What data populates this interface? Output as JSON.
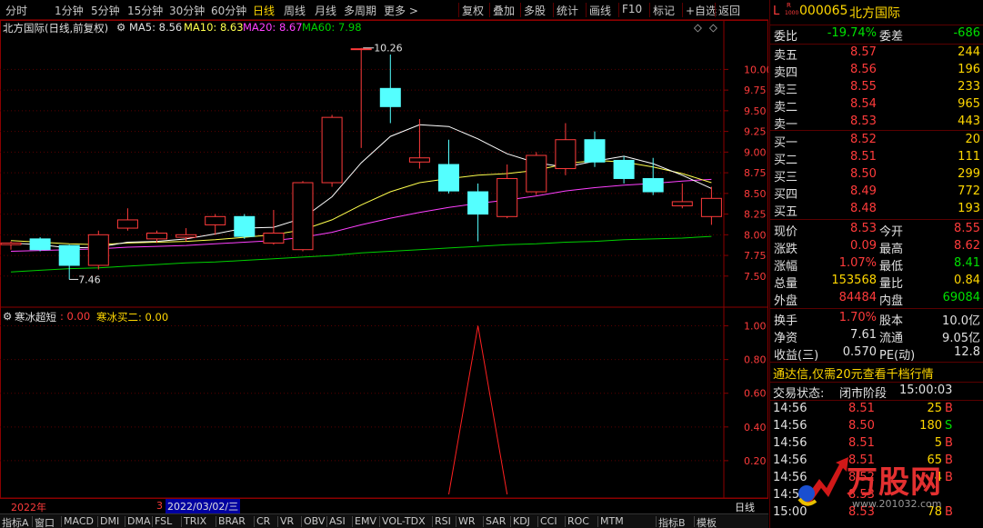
{
  "toolbar": {
    "periods": [
      "分时",
      "1分钟",
      "5分钟",
      "15分钟",
      "30分钟",
      "60分钟",
      "日线",
      "周线",
      "月线",
      "多周期",
      "更多 >"
    ],
    "active_period": "日线",
    "buttons": [
      "复权",
      "叠加",
      "多股",
      "统计",
      "画线",
      "F10",
      "标记",
      "+自选",
      "返回"
    ]
  },
  "chart_header": {
    "stock_title": "北方国际(日线,前复权)",
    "ma5": "MA5: 8.56",
    "ma10": "MA10: 8.63",
    "ma20": "MA20: 8.67",
    "ma60": "MA60: 7.98"
  },
  "indicator_header": {
    "name": "寒冰超短",
    "v1": ": 0.00",
    "v2": "寒冰买二: 0.00"
  },
  "timeline": {
    "year": "2022年",
    "marker": "3",
    "date": "2022/03/02/三"
  },
  "period_label": "日线",
  "annotations": {
    "high": "10.26",
    "low": "7.46"
  },
  "bottom_tabs": [
    "指标A",
    "窗口",
    "MACD",
    "DMI",
    "DMA",
    "FSL",
    "TRIX",
    "BRAR",
    "CR",
    "VR",
    "OBV",
    "ASI",
    "EMV",
    "VOL-TDX",
    "RSI",
    "WR",
    "SAR",
    "KDJ",
    "CCI",
    "ROC",
    "MTM",
    "指标B",
    "模板"
  ],
  "colors": {
    "up": "#ff3b3b",
    "down": "#54ffff",
    "ma5": "#ffffff",
    "ma10": "#ffff4d",
    "ma20": "#ff40ff",
    "ma60": "#00d000",
    "border": "#8b0000"
  },
  "quote": {
    "code": "000065",
    "name": "北方国际",
    "badge_l": "L",
    "badge_r": "R",
    "badge_num": "1000",
    "weibi_label": "委比",
    "weibi": "-19.74%",
    "weicha_label": "委差",
    "weicha": "-686",
    "asks": [
      {
        "label": "卖五",
        "price": "8.57",
        "vol": "244"
      },
      {
        "label": "卖四",
        "price": "8.56",
        "vol": "196"
      },
      {
        "label": "卖三",
        "price": "8.55",
        "vol": "233"
      },
      {
        "label": "卖二",
        "price": "8.54",
        "vol": "965"
      },
      {
        "label": "卖一",
        "price": "8.53",
        "vol": "443"
      }
    ],
    "bids": [
      {
        "label": "买一",
        "price": "8.52",
        "vol": "20"
      },
      {
        "label": "买二",
        "price": "8.51",
        "vol": "111"
      },
      {
        "label": "买三",
        "price": "8.50",
        "vol": "299"
      },
      {
        "label": "买四",
        "price": "8.49",
        "vol": "772"
      },
      {
        "label": "买五",
        "price": "8.48",
        "vol": "193"
      }
    ],
    "stats": [
      {
        "l1": "现价",
        "v1": "8.53",
        "l2": "今开",
        "v2": "8.55"
      },
      {
        "l1": "涨跌",
        "v1": "0.09",
        "l2": "最高",
        "v2": "8.62"
      },
      {
        "l1": "涨幅",
        "v1": "1.07%",
        "l2": "最低",
        "v2": "8.41"
      },
      {
        "l1": "总量",
        "v1": "153568",
        "l2": "量比",
        "v2": "0.84"
      },
      {
        "l1": "外盘",
        "v1": "84484",
        "l2": "内盘",
        "v2": "69084"
      }
    ],
    "stats2": [
      {
        "l1": "换手",
        "v1": "1.70%",
        "l2": "股本",
        "v2": "10.0亿"
      },
      {
        "l1": "净资",
        "v1": "7.61",
        "l2": "流通",
        "v2": "9.05亿"
      },
      {
        "l1": "收益(三)",
        "v1": "0.570",
        "l2": "PE(动)",
        "v2": "12.8"
      }
    ],
    "promo": "通达信,仅需20元查看千档行情",
    "status_label": "交易状态:",
    "status_value": "闭市阶段",
    "status_time": "15:00:03",
    "ticks": [
      {
        "time": "14:56",
        "price": "8.51",
        "vol": "25",
        "side": "B"
      },
      {
        "time": "14:56",
        "price": "8.50",
        "vol": "180",
        "side": "S"
      },
      {
        "time": "14:56",
        "price": "8.51",
        "vol": "5",
        "side": "B"
      },
      {
        "time": "14:56",
        "price": "8.51",
        "vol": "65",
        "side": "B"
      },
      {
        "time": "14:56",
        "price": "8.52",
        "vol": "4",
        "side": "B"
      },
      {
        "time": "14:56",
        "price": "8.53",
        "vol": "",
        "side": ""
      },
      {
        "time": "15:00",
        "price": "8.53",
        "vol": "78",
        "side": "B"
      }
    ],
    "watermark": "万股网",
    "watermark_url": "www.201032.com"
  },
  "chart_data": [
    {
      "type": "candlestick",
      "ylim": [
        7.3,
        10.4
      ],
      "yticks": [
        7.5,
        7.75,
        8.0,
        8.25,
        8.5,
        8.75,
        9.0,
        9.25,
        9.5,
        9.75,
        10.0
      ],
      "candles": [
        {
          "o": 7.88,
          "h": 7.92,
          "l": 7.82,
          "c": 7.9
        },
        {
          "o": 7.95,
          "h": 7.97,
          "l": 7.8,
          "c": 7.82
        },
        {
          "o": 7.87,
          "h": 7.88,
          "l": 7.46,
          "c": 7.63
        },
        {
          "o": 7.63,
          "h": 8.05,
          "l": 7.58,
          "c": 8.0
        },
        {
          "o": 8.08,
          "h": 8.32,
          "l": 8.05,
          "c": 8.18
        },
        {
          "o": 7.95,
          "h": 8.05,
          "l": 7.9,
          "c": 8.02
        },
        {
          "o": 7.97,
          "h": 8.08,
          "l": 7.92,
          "c": 8.0
        },
        {
          "o": 8.12,
          "h": 8.25,
          "l": 8.0,
          "c": 8.22
        },
        {
          "o": 8.22,
          "h": 8.25,
          "l": 7.95,
          "c": 7.98
        },
        {
          "o": 7.9,
          "h": 8.3,
          "l": 7.88,
          "c": 8.02
        },
        {
          "o": 7.82,
          "h": 8.65,
          "l": 7.8,
          "c": 8.63
        },
        {
          "o": 8.63,
          "h": 9.45,
          "l": 8.58,
          "c": 9.42
        },
        {
          "o": 10.25,
          "h": 10.26,
          "l": 9.05,
          "c": 10.25
        },
        {
          "o": 9.77,
          "h": 10.18,
          "l": 9.35,
          "c": 9.55
        },
        {
          "o": 8.88,
          "h": 9.4,
          "l": 8.8,
          "c": 8.93
        },
        {
          "o": 8.85,
          "h": 9.15,
          "l": 8.5,
          "c": 8.53
        },
        {
          "o": 8.52,
          "h": 8.62,
          "l": 7.92,
          "c": 8.25
        },
        {
          "o": 8.22,
          "h": 8.85,
          "l": 8.2,
          "c": 8.68
        },
        {
          "o": 8.52,
          "h": 9.0,
          "l": 8.48,
          "c": 8.96
        },
        {
          "o": 8.8,
          "h": 9.35,
          "l": 8.72,
          "c": 9.15
        },
        {
          "o": 9.15,
          "h": 9.25,
          "l": 8.82,
          "c": 8.88
        },
        {
          "o": 8.9,
          "h": 8.95,
          "l": 8.62,
          "c": 8.68
        },
        {
          "o": 8.68,
          "h": 8.93,
          "l": 8.48,
          "c": 8.52
        },
        {
          "o": 8.35,
          "h": 8.62,
          "l": 8.32,
          "c": 8.4
        },
        {
          "o": 8.22,
          "h": 8.58,
          "l": 8.12,
          "c": 8.44
        }
      ],
      "ma5": [
        7.9,
        7.88,
        7.84,
        7.85,
        7.91,
        7.92,
        7.95,
        8.01,
        8.08,
        8.09,
        8.2,
        8.46,
        8.87,
        9.19,
        9.33,
        9.31,
        9.16,
        8.98,
        8.87,
        8.82,
        8.89,
        8.95,
        8.86,
        8.72,
        8.56
      ],
      "ma10": [
        7.93,
        7.91,
        7.89,
        7.88,
        7.9,
        7.91,
        7.92,
        7.94,
        7.97,
        8.0,
        8.06,
        8.18,
        8.36,
        8.52,
        8.63,
        8.68,
        8.72,
        8.74,
        8.78,
        8.86,
        8.9,
        8.88,
        8.82,
        8.74,
        8.63
      ],
      "ma20": [
        7.8,
        7.81,
        7.82,
        7.83,
        7.85,
        7.86,
        7.87,
        7.89,
        7.91,
        7.93,
        7.97,
        8.03,
        8.12,
        8.2,
        8.27,
        8.33,
        8.38,
        8.42,
        8.47,
        8.53,
        8.57,
        8.6,
        8.62,
        8.65,
        8.67
      ],
      "ma60": [
        7.55,
        7.57,
        7.59,
        7.6,
        7.62,
        7.64,
        7.66,
        7.67,
        7.69,
        7.71,
        7.73,
        7.75,
        7.78,
        7.8,
        7.82,
        7.84,
        7.86,
        7.88,
        7.89,
        7.91,
        7.92,
        7.94,
        7.95,
        7.96,
        7.98
      ]
    },
    {
      "type": "line",
      "name": "寒冰买二",
      "ylim": [
        0,
        1.1
      ],
      "yticks": [
        0.2,
        0.4,
        0.6,
        0.8,
        1.0
      ],
      "x_index": [
        15,
        16,
        17
      ],
      "values": [
        0.0,
        1.0,
        0.0
      ]
    }
  ]
}
